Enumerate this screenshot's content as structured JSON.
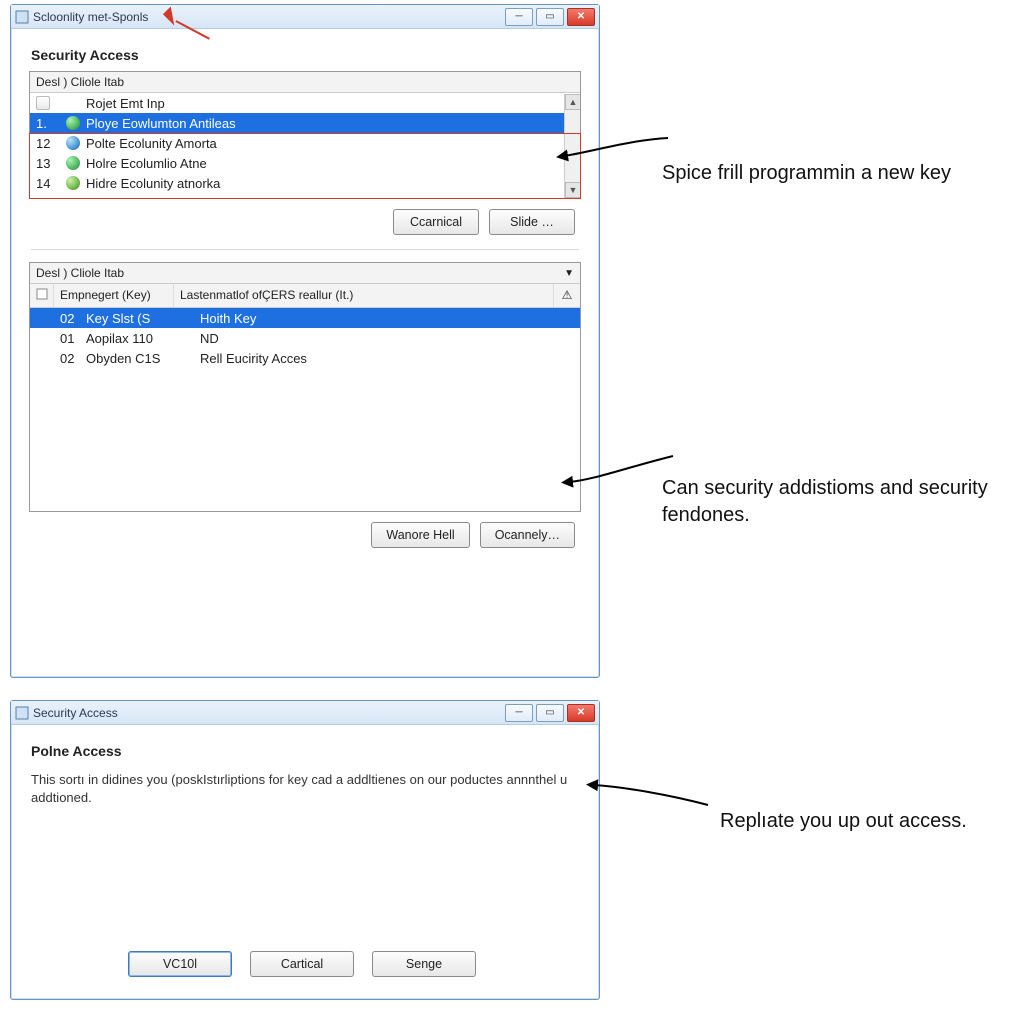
{
  "window1": {
    "title": "Scloonlity met-Sponls",
    "section_title": "Security Access",
    "list_header": "Desl ) Cliole Itab",
    "rows": [
      {
        "num": "",
        "icon": "doc",
        "label": "Rojet Emt Inp"
      },
      {
        "num": "1.",
        "icon": "green",
        "label": "Ploye Eowlumton Antileas"
      },
      {
        "num": "12",
        "icon": "blue",
        "label": "Polte Ecolunity Amorta"
      },
      {
        "num": "13",
        "icon": "green",
        "label": "Holre Ecolumlio Atne"
      },
      {
        "num": "14",
        "icon": "leaf",
        "label": "Hidre Ecolunity atnorka"
      }
    ],
    "buttons": {
      "cancel": "Ccarnical",
      "slide": "Slide …"
    },
    "table": {
      "header": "Desl ) Cliole Itab",
      "col_emp": "Empnegert (Key)",
      "col_last": "Lastenmatlof ofÇERS reallur (It.)",
      "rows": [
        {
          "id": "02",
          "c1": "Key Slst (S",
          "c2": "Hoith Key",
          "selected": true
        },
        {
          "id": "01",
          "c1": "Aopilax 110",
          "c2": "ND"
        },
        {
          "id": "02",
          "c1": "Obyden C1S",
          "c2": "Rell Eucirity Acces"
        }
      ]
    },
    "buttons2": {
      "wanore": "Wanore Hell",
      "ocannely": "Ocannely…"
    }
  },
  "window2": {
    "title": "Security Access",
    "heading": "Polne Access",
    "text": "This sortı in didines you (poskIstırliptions for key cad a addltienes on our poductes annnthel u addtioned.",
    "buttons": {
      "vc": "VC10l",
      "cartical": "Cartical",
      "senge": "Senge"
    }
  },
  "annotations": {
    "a1": "Spice frill programmin a new key",
    "a2": "Can security addistioms and security fendones.",
    "a3": "Replıate you up out access."
  }
}
